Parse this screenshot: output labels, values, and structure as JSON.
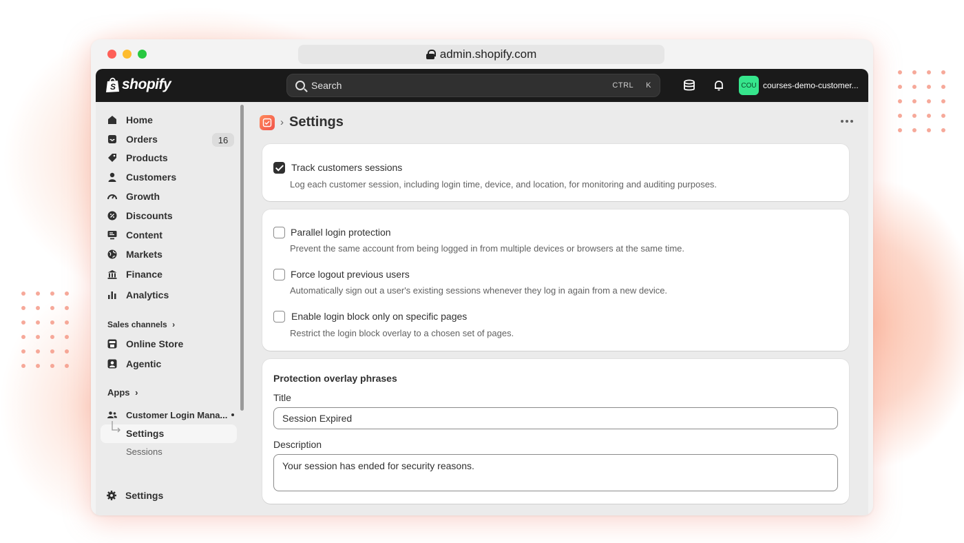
{
  "browser": {
    "url": "admin.shopify.com"
  },
  "topbar": {
    "logo_text": "shopify",
    "search_placeholder": "Search",
    "shortcut_ctrl": "CTRL",
    "shortcut_k": "K",
    "store_avatar": "COU",
    "store_name": "courses-demo-customer..."
  },
  "sidebar": {
    "items": [
      {
        "label": "Home"
      },
      {
        "label": "Orders",
        "count": "16"
      },
      {
        "label": "Products"
      },
      {
        "label": "Customers"
      },
      {
        "label": "Growth"
      },
      {
        "label": "Discounts"
      },
      {
        "label": "Content"
      },
      {
        "label": "Markets"
      },
      {
        "label": "Finance"
      },
      {
        "label": "Analytics"
      }
    ],
    "sales_channels_label": "Sales channels",
    "sales_channels": [
      {
        "label": "Online Store"
      },
      {
        "label": "Agentic"
      }
    ],
    "apps_label": "Apps",
    "app_name": "Customer Login Mana...",
    "app_sub_items": [
      {
        "label": "Settings"
      },
      {
        "label": "Sessions"
      }
    ],
    "settings_label": "Settings"
  },
  "page": {
    "title": "Settings",
    "card1": {
      "option": {
        "label": "Track customers sessions",
        "help": "Log each customer session, including login time, device, and location, for monitoring and auditing purposes.",
        "checked": true
      }
    },
    "card2": {
      "options": [
        {
          "label": "Parallel login protection",
          "help": "Prevent the same account from being logged in from multiple devices or browsers at the same time.",
          "checked": false
        },
        {
          "label": "Force logout previous users",
          "help": "Automatically sign out a user's existing sessions whenever they log in again from a new device.",
          "checked": false
        },
        {
          "label": "Enable login block only on specific pages",
          "help": "Restrict the login block overlay to a chosen set of pages.",
          "checked": false
        }
      ]
    },
    "card3": {
      "heading": "Protection overlay phrases",
      "title_label": "Title",
      "title_value": "Session Expired",
      "description_label": "Description",
      "description_value": "Your session has ended for security reasons."
    }
  },
  "colors": {
    "accent_green": "#36e58c",
    "topbar": "#1a1a1a",
    "app_icon": "#f0524a"
  }
}
